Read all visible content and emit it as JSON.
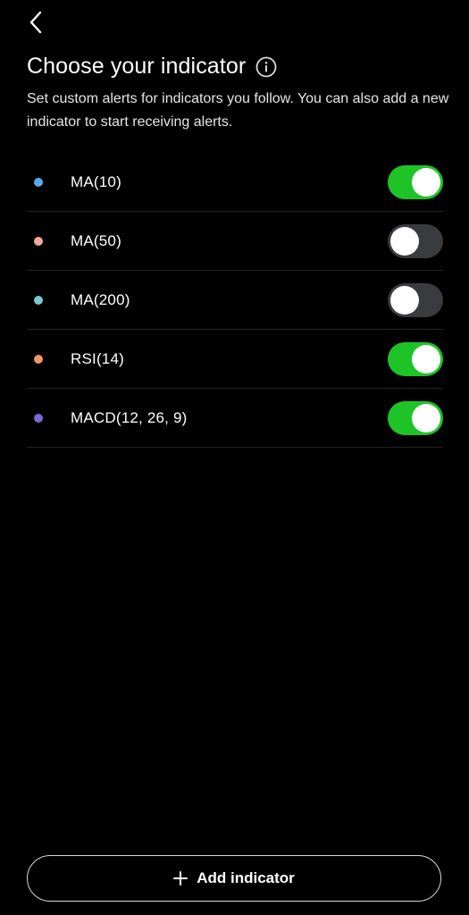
{
  "header": {
    "back_icon": "chevron-left-icon",
    "title": "Choose your indicator",
    "info_icon": "info-circle-icon",
    "subtitle": "Set custom alerts for indicators you follow. You can also add a new indicator to start receiving alerts."
  },
  "indicators": [
    {
      "label": "MA(10)",
      "dot_color": "#5aa9f0",
      "enabled": true
    },
    {
      "label": "MA(50)",
      "dot_color": "#f0a89c",
      "enabled": false
    },
    {
      "label": "MA(200)",
      "dot_color": "#7cc9cf",
      "enabled": false
    },
    {
      "label": "RSI(14)",
      "dot_color": "#f0956a",
      "enabled": true
    },
    {
      "label": "MACD(12, 26, 9)",
      "dot_color": "#7b68d6",
      "enabled": true
    }
  ],
  "add_button": {
    "icon": "plus-icon",
    "label": "Add indicator"
  },
  "colors": {
    "background": "#000000",
    "toggle_on": "#1ec328",
    "toggle_off": "#3a3b3f",
    "divider": "#222326"
  }
}
